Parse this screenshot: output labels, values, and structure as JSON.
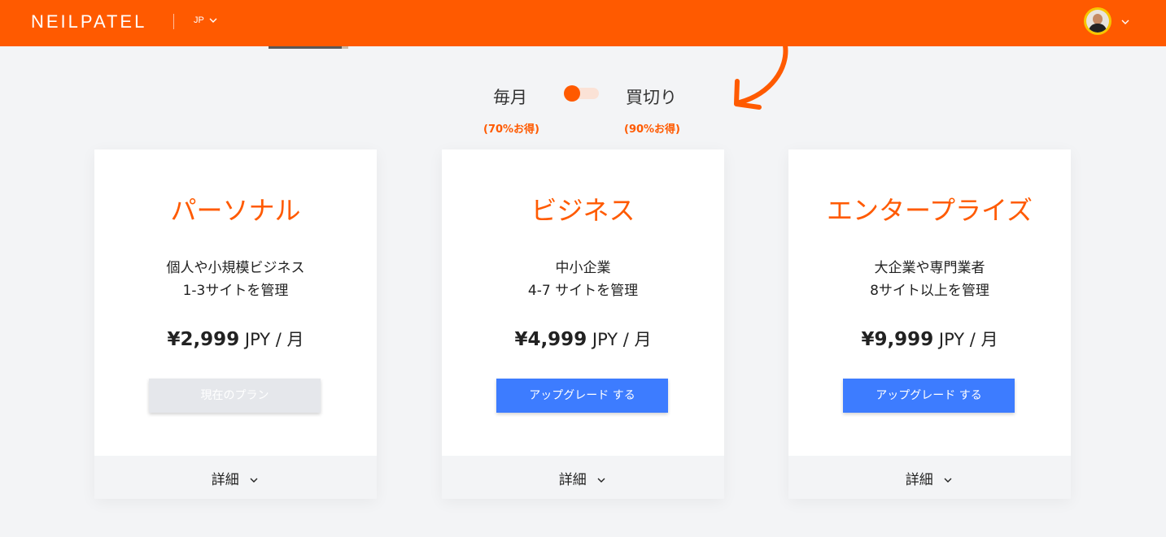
{
  "header": {
    "logo": "NEILPATEL",
    "language": "JP"
  },
  "billing_toggle": {
    "monthly_label": "毎月",
    "monthly_discount": "(70%お得)",
    "lifetime_label": "買切り",
    "lifetime_discount": "(90%お得)",
    "selected": "monthly"
  },
  "plans": [
    {
      "name": "パーソナル",
      "desc_line1": "個人や小規模ビジネス",
      "desc_line2": "1-3サイトを管理",
      "price": "¥2,999",
      "unit": "JPY / 月",
      "button": "現在のプラン",
      "details": "詳細"
    },
    {
      "name": "ビジネス",
      "desc_line1": "中小企業",
      "desc_line2": "4-7 サイトを管理",
      "price": "¥4,999",
      "unit": "JPY / 月",
      "button": "アップグレード する",
      "details": "詳細"
    },
    {
      "name": "エンタープライズ",
      "desc_line1": "大企業や専門業者",
      "desc_line2": "8サイト以上を管理",
      "price": "¥9,999",
      "unit": "JPY / 月",
      "button": "アップグレード する",
      "details": "詳細"
    }
  ],
  "colors": {
    "brand": "#ff5a00",
    "button_primary": "#3d7cff",
    "button_disabled": "#e5e7eb",
    "background": "#f3f4f6"
  },
  "icons": [
    "chevron-down-icon",
    "avatar",
    "curved-arrow-icon"
  ]
}
